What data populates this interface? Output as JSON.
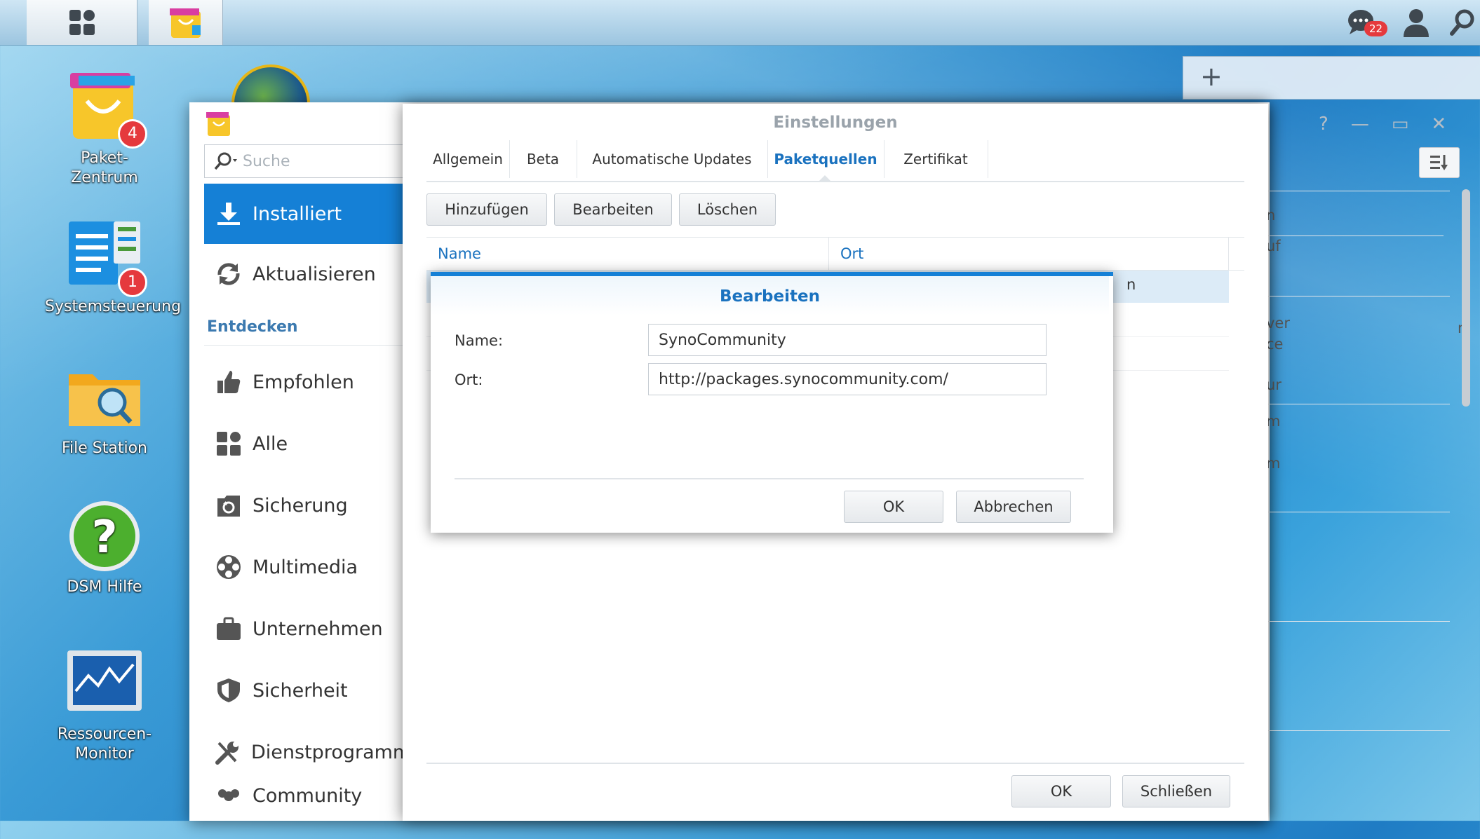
{
  "taskbar": {
    "notification_count": "22"
  },
  "desktop": {
    "icons": [
      {
        "label_line1": "Paket-",
        "label_line2": "Zentrum",
        "badge": "4"
      },
      {
        "label_line1": "Systemsteuerung",
        "label_line2": "",
        "badge": "1"
      },
      {
        "label_line1": "File Station",
        "label_line2": "",
        "badge": ""
      },
      {
        "label_line1": "DSM Hilfe",
        "label_line2": "",
        "badge": ""
      },
      {
        "label_line1": "Ressourcen-",
        "label_line2": "Monitor",
        "badge": ""
      }
    ]
  },
  "package_center": {
    "search_placeholder": "Suche",
    "nav": {
      "installed": "Installiert",
      "update": "Aktualisieren",
      "section_discover": "Entdecken",
      "recommended": "Empfohlen",
      "all": "Alle",
      "backup": "Sicherung",
      "multimedia": "Multimedia",
      "business": "Unternehmen",
      "security": "Sicherheit",
      "utilities": "Dienstprogramme",
      "community": "Community"
    },
    "background_fragments": [
      "n",
      "uf",
      "ver",
      "ce",
      "ur",
      "m",
      "m"
    ]
  },
  "settings": {
    "title": "Einstellungen",
    "tabs": [
      "Allgemein",
      "Beta",
      "Automatische Updates",
      "Paketquellen",
      "Zertifikat"
    ],
    "active_tab": "Paketquellen",
    "toolbar": {
      "add": "Hinzufügen",
      "edit": "Bearbeiten",
      "delete": "Löschen"
    },
    "table": {
      "columns": [
        "Name",
        "Ort"
      ],
      "row_fragment": "n"
    },
    "footer": {
      "ok": "OK",
      "close": "Schließen"
    }
  },
  "dialog": {
    "title": "Bearbeiten",
    "name_label": "Name:",
    "name_value": "SynoCommunity",
    "location_label": "Ort:",
    "location_value": "http://packages.synocommunity.com/",
    "ok": "OK",
    "cancel": "Abbrechen"
  },
  "colors": {
    "accent": "#1580d6",
    "badge": "#e5393d"
  }
}
